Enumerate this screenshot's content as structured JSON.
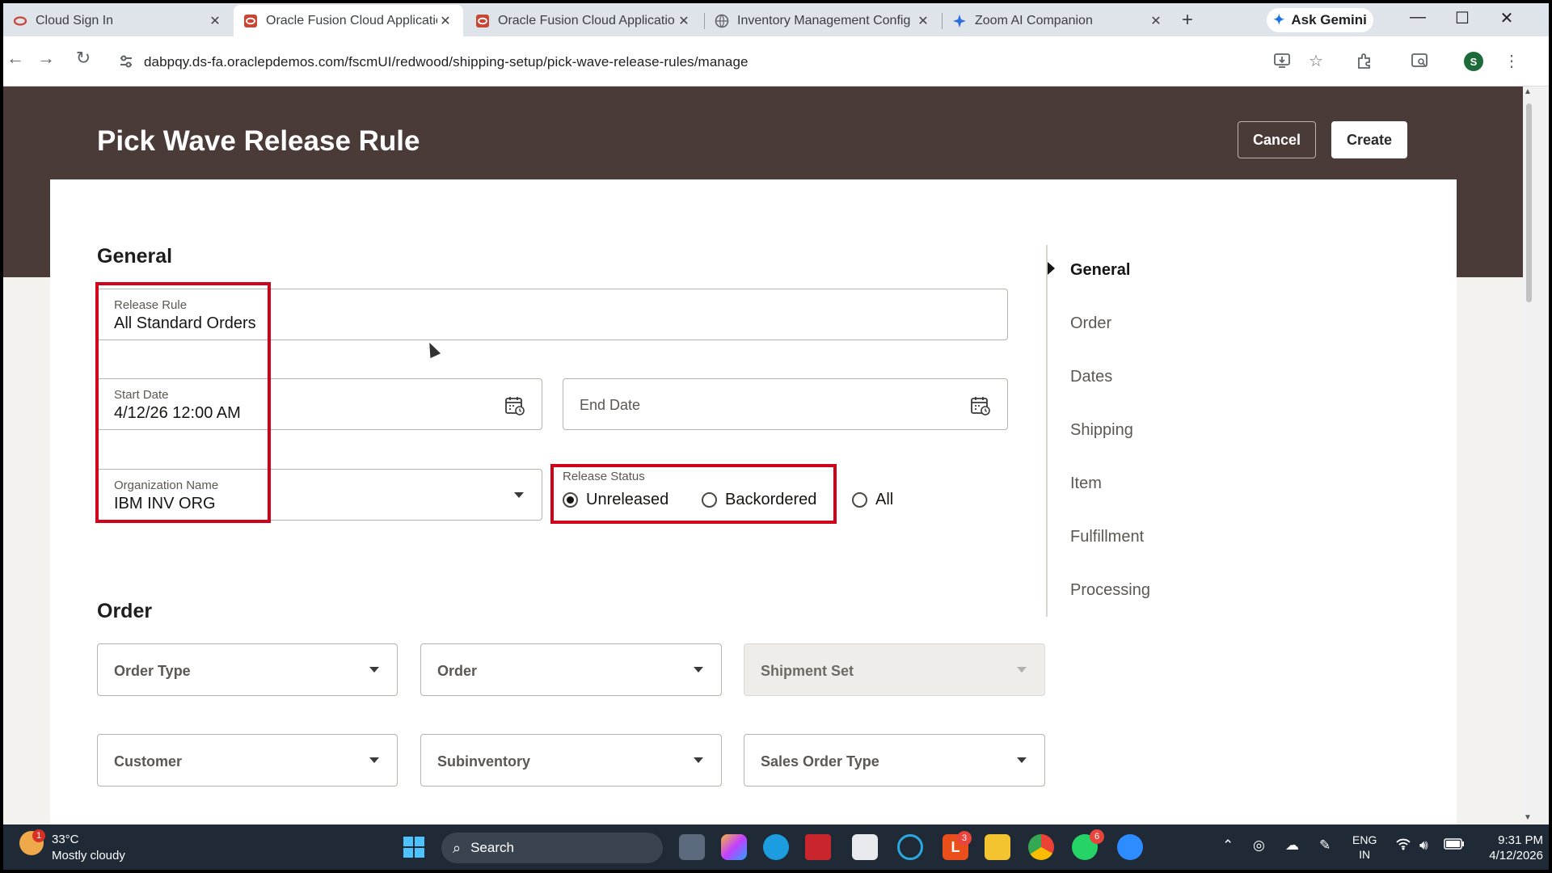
{
  "browser": {
    "tabs": [
      {
        "title": "Cloud Sign In",
        "active": false
      },
      {
        "title": "Oracle Fusion Cloud Applicatio",
        "active": true
      },
      {
        "title": "Oracle Fusion Cloud Applicatio",
        "active": false
      },
      {
        "title": "Inventory Management Config",
        "active": false
      },
      {
        "title": "Zoom AI Companion",
        "active": false
      }
    ],
    "close_glyph": "✕",
    "new_tab_glyph": "+",
    "gemini_label": "Ask Gemini",
    "url": "dabpqy.ds-fa.oraclepdemos.com/fscmUI/redwood/shipping-setup/pick-wave-release-rules/manage",
    "profile_initial": "S"
  },
  "header": {
    "title": "Pick Wave Release Rule",
    "cancel_label": "Cancel",
    "create_label": "Create"
  },
  "general": {
    "section_title": "General",
    "release_rule": {
      "label": "Release Rule",
      "value": "All Standard Orders"
    },
    "start_date": {
      "label": "Start Date",
      "value": "4/12/26 12:00 AM"
    },
    "end_date": {
      "label": "End Date"
    },
    "organization": {
      "label": "Organization Name",
      "value": "IBM INV ORG"
    },
    "release_status": {
      "label": "Release Status",
      "options": [
        "Unreleased",
        "Backordered",
        "All"
      ],
      "selected": "Unreleased"
    }
  },
  "order": {
    "section_title": "Order",
    "fields": {
      "order_type": "Order Type",
      "order": "Order",
      "shipment_set": "Shipment Set",
      "customer": "Customer",
      "subinventory": "Subinventory",
      "sales_order_type": "Sales Order Type"
    }
  },
  "section_nav": {
    "items": [
      "General",
      "Order",
      "Dates",
      "Shipping",
      "Item",
      "Fulfillment",
      "Processing"
    ],
    "active": "General"
  },
  "taskbar": {
    "weather_temp": "33°C",
    "weather_desc": "Mostly cloudy",
    "weather_badge": "1",
    "search_label": "Search",
    "badge_l": "3",
    "badge_whatsapp": "6",
    "lang_1": "ENG",
    "lang_2": "IN",
    "time": "9:31 PM",
    "date": "4/12/2026"
  },
  "colors": {
    "banner": "#4a3a38",
    "highlight": "#d0021b",
    "taskbar": "#202a36"
  }
}
